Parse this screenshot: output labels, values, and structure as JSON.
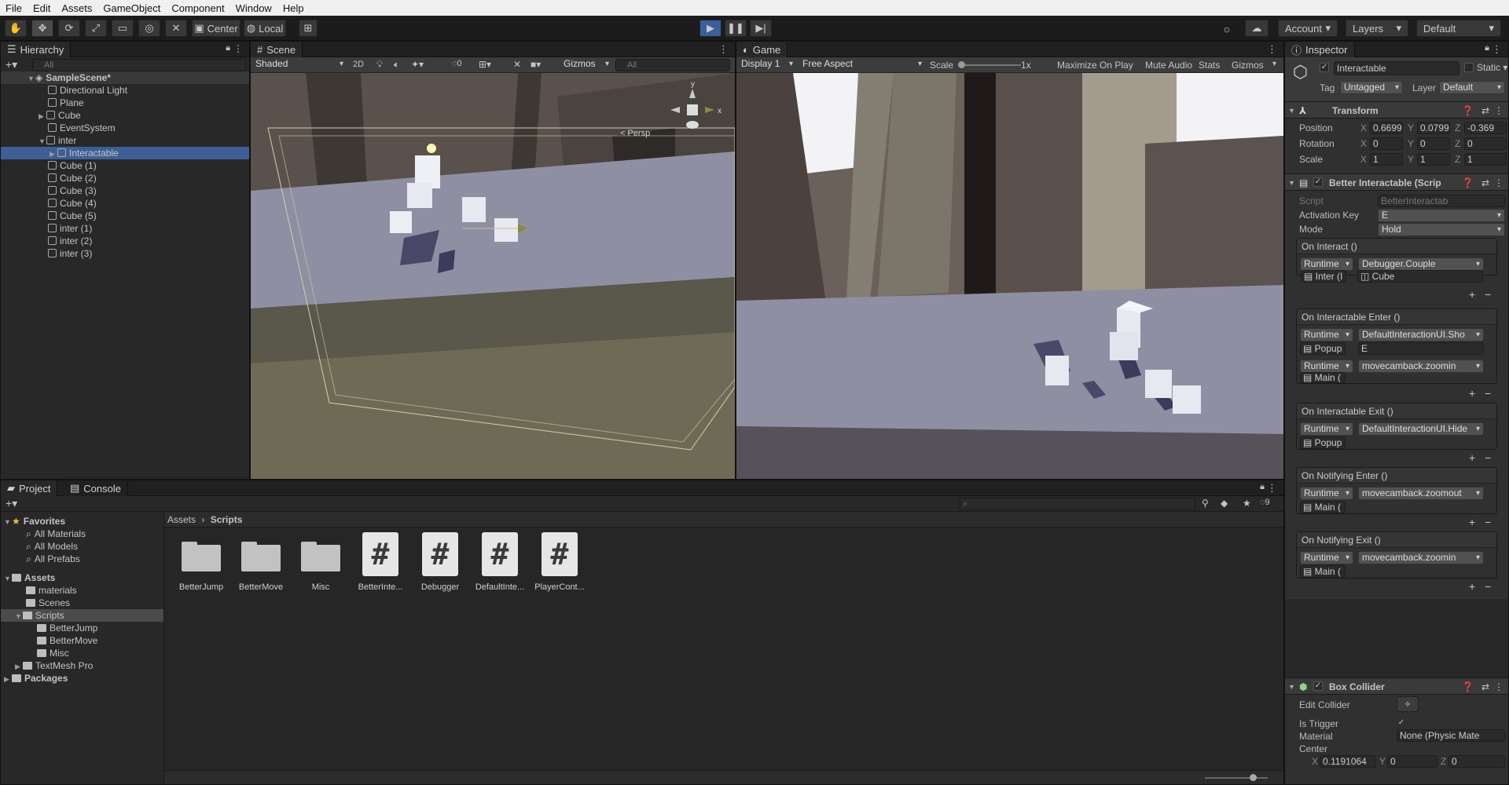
{
  "menu": [
    "File",
    "Edit",
    "Assets",
    "GameObject",
    "Component",
    "Window",
    "Help"
  ],
  "toolbar": {
    "pivot": "Center",
    "space": "Local",
    "account": "Account",
    "layers": "Layers",
    "layout": "Default"
  },
  "hierarchy": {
    "tab": "Hierarchy",
    "search": "All",
    "scene": "SampleScene*",
    "items": [
      "Directional Light",
      "Plane",
      "Cube",
      "EventSystem",
      "inter",
      "Interactable",
      "Cube (1)",
      "Cube (2)",
      "Cube (3)",
      "Cube (4)",
      "Cube (5)",
      "inter (1)",
      "inter (2)",
      "inter (3)"
    ]
  },
  "scene": {
    "tab": "Scene",
    "shading": "Shaded",
    "mode2d": "2D",
    "hidden_count": "0",
    "gizmos": "Gizmos",
    "search": "All",
    "persp": "< Persp",
    "axis_y": "y",
    "axis_x": "x"
  },
  "game": {
    "tab": "Game",
    "display": "Display 1",
    "aspect": "Free Aspect",
    "scale_label": "Scale",
    "scale_value": "1x",
    "max": "Maximize On Play",
    "mute": "Mute Audio",
    "stats": "Stats",
    "gizmos": "Gizmos"
  },
  "inspector": {
    "tab": "Inspector",
    "name": "Interactable",
    "static": "Static",
    "tag_label": "Tag",
    "tag": "Untagged",
    "layer_label": "Layer",
    "layer": "Default",
    "transform": {
      "title": "Transform",
      "pos_label": "Position",
      "rot_label": "Rotation",
      "scale_label": "Scale",
      "pos": [
        "0.6699",
        "0.0799",
        "-0.369"
      ],
      "rot": [
        "0",
        "0",
        "0"
      ],
      "scl": [
        "1",
        "1",
        "1"
      ]
    },
    "script_comp": {
      "title": "Better Interactable (Scrip",
      "script_label": "Script",
      "script": "BetterInteractab",
      "key_label": "Activation Key",
      "key": "E",
      "mode_label": "Mode",
      "mode": "Hold"
    },
    "events": [
      {
        "title": "On Interact ()",
        "rows": [
          {
            "runtime": "Runtime",
            "func": "Debugger.Couple",
            "obj": "Inter (I",
            "arg": "Cube"
          }
        ]
      },
      {
        "title": "On Interactable Enter ()",
        "rows": [
          {
            "runtime": "Runtime",
            "func": "DefaultInteractionUI.Sho",
            "obj": "Popup",
            "arg": "E"
          },
          {
            "runtime": "Runtime",
            "func": "movecamback.zoomin",
            "obj": "Main (",
            "arg": ""
          }
        ]
      },
      {
        "title": "On Interactable Exit ()",
        "rows": [
          {
            "runtime": "Runtime",
            "func": "DefaultInteractionUI.Hide",
            "obj": "Popup",
            "arg": ""
          }
        ]
      },
      {
        "title": "On Notifying Enter ()",
        "rows": [
          {
            "runtime": "Runtime",
            "func": "movecamback.zoomout",
            "obj": "Main (",
            "arg": ""
          }
        ]
      },
      {
        "title": "On Notifying Exit ()",
        "rows": [
          {
            "runtime": "Runtime",
            "func": "movecamback.zoomin",
            "obj": "Main (",
            "arg": ""
          }
        ]
      }
    ],
    "box": {
      "title": "Box Collider",
      "edit_label": "Edit Collider",
      "trigger_label": "Is Trigger",
      "material_label": "Material",
      "material": "None (Physic Mate",
      "center_label": "Center",
      "center": [
        "0.1191064",
        "0",
        "0"
      ]
    }
  },
  "project": {
    "tab": "Project",
    "console": "Console",
    "hidden_count": "9",
    "breadcrumb_root": "Assets",
    "breadcrumb_cur": "Scripts",
    "tree": [
      "Favorites",
      "All Materials",
      "All Models",
      "All Prefabs",
      "Assets",
      "materials",
      "Scenes",
      "Scripts",
      "BetterJump",
      "BetterMove",
      "Misc",
      "TextMesh Pro",
      "Packages"
    ],
    "assets": [
      {
        "type": "folder",
        "name": "BetterJump"
      },
      {
        "type": "folder",
        "name": "BetterMove"
      },
      {
        "type": "folder",
        "name": "Misc"
      },
      {
        "type": "script",
        "name": "BetterInte..."
      },
      {
        "type": "script",
        "name": "Debugger"
      },
      {
        "type": "script",
        "name": "DefaultInte..."
      },
      {
        "type": "script",
        "name": "PlayerCont..."
      }
    ]
  },
  "colors": {
    "accent": "#3e5f96",
    "panel": "#282828",
    "header": "#3c3c3c"
  }
}
